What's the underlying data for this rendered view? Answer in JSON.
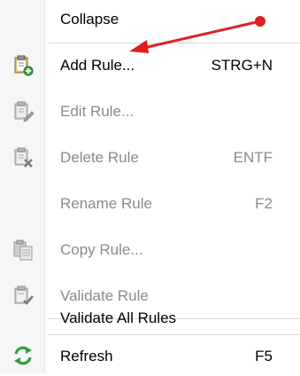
{
  "menu": {
    "collapse": "Collapse",
    "add_rule": {
      "label": "Add Rule...",
      "shortcut": "STRG+N"
    },
    "edit_rule": {
      "label": "Edit Rule..."
    },
    "delete_rule": {
      "label": "Delete Rule",
      "shortcut": "ENTF"
    },
    "rename_rule": {
      "label": "Rename Rule",
      "shortcut": "F2"
    },
    "copy_rule": {
      "label": "Copy Rule..."
    },
    "validate_rule": {
      "label": "Validate Rule"
    },
    "validate_all": "Validate All Rules",
    "refresh": {
      "label": "Refresh",
      "shortcut": "F5"
    }
  },
  "icons": {
    "add_rule": "clipboard-add-icon",
    "edit_rule": "clipboard-edit-icon",
    "delete_rule": "clipboard-delete-icon",
    "copy_rule": "clipboard-copy-icon",
    "validate_rule": "clipboard-check-icon",
    "refresh": "refresh-icon"
  },
  "colors": {
    "annotation_red": "#e02020",
    "refresh_green": "#2aa13a",
    "disabled_text": "#8a8a8a"
  }
}
